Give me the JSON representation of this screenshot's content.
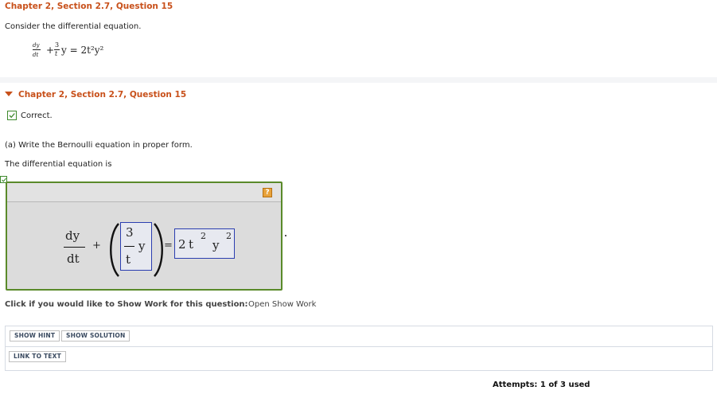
{
  "header": {
    "title": "Chapter 2, Section 2.7, Question 15",
    "intro": "Consider the differential equation."
  },
  "problem_equation": {
    "d_num": "dy",
    "d_den": "dt",
    "plus": "+",
    "coef_num": "3",
    "coef_den": "t",
    "rhs": "y = 2t²y²"
  },
  "section": {
    "title": "Chapter 2, Section 2.7, Question 15",
    "status": "Correct.",
    "part_a": "(a) Write the Bernoulli equation in proper form.",
    "prompt": "The differential equation is"
  },
  "answer": {
    "lhs_num": "dy",
    "lhs_den": "dt",
    "plus": "+",
    "frac_num": "3",
    "frac_den": "t",
    "var": "y",
    "equals": "=",
    "rhs_coef": "2",
    "rhs_t": "t",
    "rhs_t_exp": "2",
    "rhs_y": "y",
    "rhs_y_exp": "2",
    "help_icon": "?"
  },
  "show_work": {
    "prompt": "Click if you would like to Show Work for this question:",
    "link": "Open Show Work"
  },
  "buttons": {
    "hint": "SHOW HINT",
    "solution": "SHOW SOLUTION",
    "link_to_text": "LINK TO TEXT"
  },
  "attempts": "Attempts: 1 of 3 used",
  "colors": {
    "title": "#c8501a",
    "correct_border": "#5a8a2a",
    "input_border": "#2b3eb0"
  }
}
